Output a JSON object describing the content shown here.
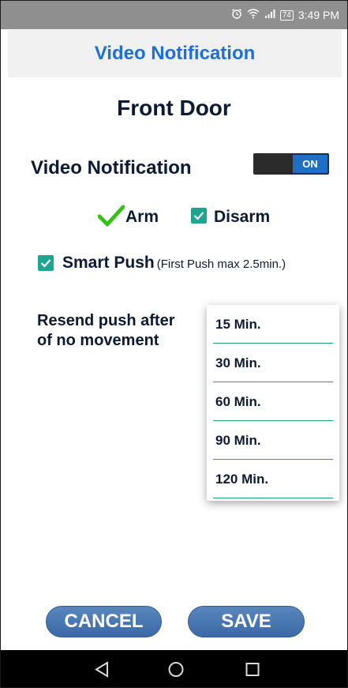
{
  "status_bar": {
    "battery": "74",
    "time": "3:49 PM",
    "icons": [
      "alarm-icon",
      "wifi-icon",
      "signal-icon",
      "battery-icon"
    ]
  },
  "header": {
    "title": "Video Notification"
  },
  "device": {
    "name": "Front Door"
  },
  "video_notification": {
    "label": "Video Notification",
    "toggle_state": "ON"
  },
  "arm_options": {
    "arm": {
      "label": "Arm",
      "checked": true,
      "mark": "check-icon"
    },
    "disarm": {
      "label": "Disarm",
      "checked": true
    }
  },
  "smart_push": {
    "label": "Smart Push",
    "note": "(First Push max 2.5min.)",
    "checked": true
  },
  "resend": {
    "label_line1": "Resend push after",
    "label_line2": "of no movement",
    "options": [
      "15 Min.",
      "30 Min.",
      "60 Min.",
      "90 Min.",
      "120 Min."
    ]
  },
  "buttons": {
    "cancel": "CANCEL",
    "save": "SAVE"
  },
  "colors": {
    "accent": "#1d6fd6",
    "checkbox": "#1ea58f",
    "check_green": "#34c217",
    "button": "#4a79b3",
    "divider": "#1ea56a"
  },
  "nav_bar": {
    "icons": [
      "back-icon",
      "home-icon",
      "recents-icon"
    ]
  }
}
